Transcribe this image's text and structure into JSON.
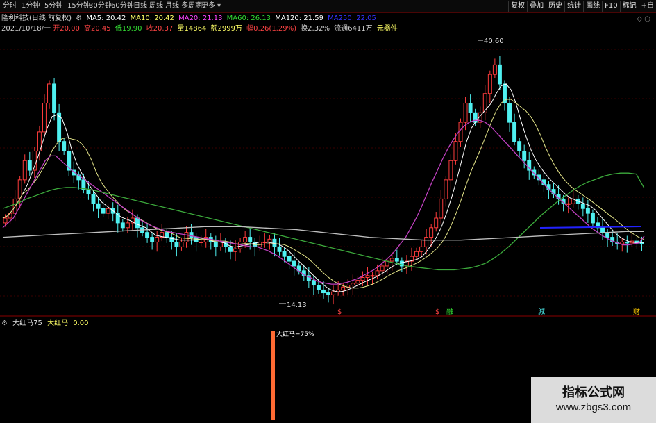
{
  "toolbar": {
    "stock_name": "隆利科技",
    "period_items": [
      "分时",
      "1分钟",
      "5分钟",
      "15分钟",
      "30分钟",
      "60分钟",
      "日线",
      "周线",
      "月线",
      "多周期",
      "更多"
    ],
    "right_buttons": [
      "复权",
      "叠加",
      "历史",
      "统计",
      "画线",
      "F10",
      "标记",
      "+自"
    ]
  },
  "ma_legend": {
    "title": "隆利科技(日线 前复权)",
    "items": [
      {
        "text": "MA5: 20.42",
        "color": "#ffffff"
      },
      {
        "text": "MA10: 20.42",
        "color": "#ffff66"
      },
      {
        "text": "MA20: 21.13",
        "color": "#ff44ff"
      },
      {
        "text": "MA60: 26.13",
        "color": "#33dd33"
      },
      {
        "text": "MA120: 21.59",
        "color": "#ffffff"
      },
      {
        "text": "MA250: 22.05",
        "color": "#3333ff"
      }
    ]
  },
  "quote": {
    "date": "2021/10/18/一",
    "items": [
      {
        "text": "开20.00",
        "color": "#ff4444"
      },
      {
        "text": "高20.45",
        "color": "#ff4444"
      },
      {
        "text": "低19.90",
        "color": "#33dd33"
      },
      {
        "text": "收20.37",
        "color": "#ff4444"
      },
      {
        "text": "量14864",
        "color": "#ffff66"
      },
      {
        "text": "额2999万",
        "color": "#ffff66"
      },
      {
        "text": "幅0.26(1.29%)",
        "color": "#ff4444"
      },
      {
        "text": "换2.32%",
        "color": "#d0d0d0"
      },
      {
        "text": "流通6411万",
        "color": "#d0d0d0"
      },
      {
        "text": "元器件",
        "color": "#ffff66"
      }
    ]
  },
  "annotations": {
    "high": "40.60",
    "low": "14.13",
    "event_marks": [
      "$",
      "$",
      "融",
      "減",
      "财",
      "融"
    ],
    "indicator_label": "大红马=75%"
  },
  "indicator": {
    "name": "大红马75",
    "line_name": "大红马",
    "value": "0.00"
  },
  "watermark": {
    "title": "指标公式网",
    "url": "www.zbgs3.com"
  },
  "colors": {
    "up": "#ff3c3c",
    "down": "#4ff0f0",
    "ma5": "#ffffff",
    "ma10": "#e6e68a",
    "ma20": "#c040c0",
    "ma60": "#3caa3c",
    "ma120": "#c0c0c0",
    "indicator_bar": "#ff6a33"
  },
  "chart_data": {
    "type": "candlestick",
    "price_range": [
      13.5,
      42
    ],
    "high": 40.6,
    "low": 14.13,
    "closes": [
      23,
      23.5,
      25,
      27,
      29,
      28,
      30,
      32,
      35,
      37,
      34,
      31,
      30,
      28,
      27.5,
      27,
      26,
      25.5,
      24.5,
      24,
      23.5,
      24,
      23.5,
      22.5,
      22,
      22.5,
      23,
      22,
      21.5,
      21,
      20.5,
      21,
      21.5,
      21,
      20.5,
      20,
      20.5,
      21.5,
      21,
      20.5,
      20.5,
      21,
      20.5,
      20,
      20.5,
      20,
      19.5,
      19.8,
      20.5,
      21,
      20.5,
      20,
      20.5,
      20.5,
      20.8,
      20,
      19.5,
      19,
      18.5,
      18,
      17.5,
      17,
      16.5,
      16,
      15.5,
      15.2,
      15,
      15.3,
      15.5,
      15.8,
      16,
      16.2,
      16.5,
      16.8,
      17,
      17,
      17.5,
      18,
      18.5,
      18.8,
      18.5,
      18,
      18.5,
      19,
      19.5,
      20,
      21,
      22,
      23,
      25,
      27,
      29,
      31,
      33,
      35,
      34,
      33,
      34,
      36,
      38,
      39,
      37,
      35,
      33,
      31,
      30,
      29,
      28,
      27.5,
      27,
      26.5,
      26,
      25.5,
      25,
      24.5,
      24.5,
      25,
      24.5,
      24,
      23.5,
      22.5,
      22,
      21.5,
      21,
      20.5,
      20.3,
      20.5,
      20.4,
      20.6,
      20.4,
      20.37
    ],
    "ma20": [
      22,
      22.5,
      23,
      24,
      25,
      26,
      27,
      28,
      29,
      29.5,
      29.5,
      29,
      28.5,
      28,
      27.6,
      27.2,
      26.8,
      26.4,
      26,
      25.6,
      25.2,
      24.8,
      24.4,
      24,
      23.6,
      23.2,
      22.8,
      22.5,
      22.2,
      22,
      21.8,
      21.6,
      21.5,
      21.4,
      21.3,
      21.2,
      21.1,
      21,
      20.9,
      20.8,
      20.7,
      20.6,
      20.5,
      20.4,
      20.3,
      20.2,
      20.1,
      20,
      20,
      19.8,
      19.6,
      19.3,
      19,
      18.6,
      18.2,
      17.8,
      17.4,
      17,
      16.8,
      16.5,
      16.3,
      16.2,
      16.1,
      16.1,
      16.2,
      16.3,
      16.5,
      16.7,
      17,
      17.3,
      17.6,
      18,
      18.5,
      19,
      19.6,
      20.3,
      21,
      22,
      23,
      24.2,
      25.5,
      26.8,
      28,
      29.2,
      30.3,
      31.2,
      32,
      32.6,
      33,
      33.2,
      33.2,
      33,
      32.6,
      32,
      31.4,
      30.8,
      30.2,
      29.6,
      29,
      28.4,
      27.8,
      27.2,
      26.6,
      26,
      25.5,
      25,
      24.5,
      24,
      23.5,
      23,
      22.5,
      22,
      21.6,
      21.2,
      20.9,
      20.6,
      20.4,
      20.2,
      20.2,
      20.3,
      20.4,
      21.13
    ],
    "ma60": [
      24,
      24.3,
      24.6,
      25,
      25.3,
      25.6,
      25.9,
      26.1,
      26.2,
      26.2,
      26.1,
      26,
      25.8,
      25.6,
      25.4,
      25.2,
      25,
      24.8,
      24.6,
      24.4,
      24.2,
      24,
      23.8,
      23.6,
      23.4,
      23.2,
      23,
      22.8,
      22.6,
      22.4,
      22.2,
      22,
      21.8,
      21.6,
      21.4,
      21.2,
      21,
      20.8,
      20.6,
      20.4,
      20.2,
      20,
      19.8,
      19.6,
      19.4,
      19.2,
      19,
      18.8,
      18.6,
      18.4,
      18.2,
      18,
      17.9,
      17.8,
      17.7,
      17.6,
      17.6,
      17.6,
      17.7,
      17.8,
      18,
      18.3,
      18.8,
      19.4,
      20.1,
      20.9,
      21.7,
      22.5,
      23.3,
      24,
      24.7,
      25.3,
      25.9,
      26.4,
      26.8,
      27.1,
      27.4,
      27.6,
      27.7,
      27.7,
      27.6,
      26.13
    ],
    "ma120": [
      21,
      21.1,
      21.2,
      21.3,
      21.4,
      21.5,
      21.6,
      21.7,
      21.8,
      21.9,
      22,
      22.1,
      22.1,
      22.1,
      22,
      21.9,
      21.8,
      21.6,
      21.4,
      21.2,
      21,
      20.9,
      20.8,
      20.7,
      20.7,
      20.7,
      20.8,
      20.9,
      21,
      21.1,
      21.2,
      21.3,
      21.4,
      21.5,
      21.6,
      21.59
    ],
    "indicator_bar_value": 75
  }
}
